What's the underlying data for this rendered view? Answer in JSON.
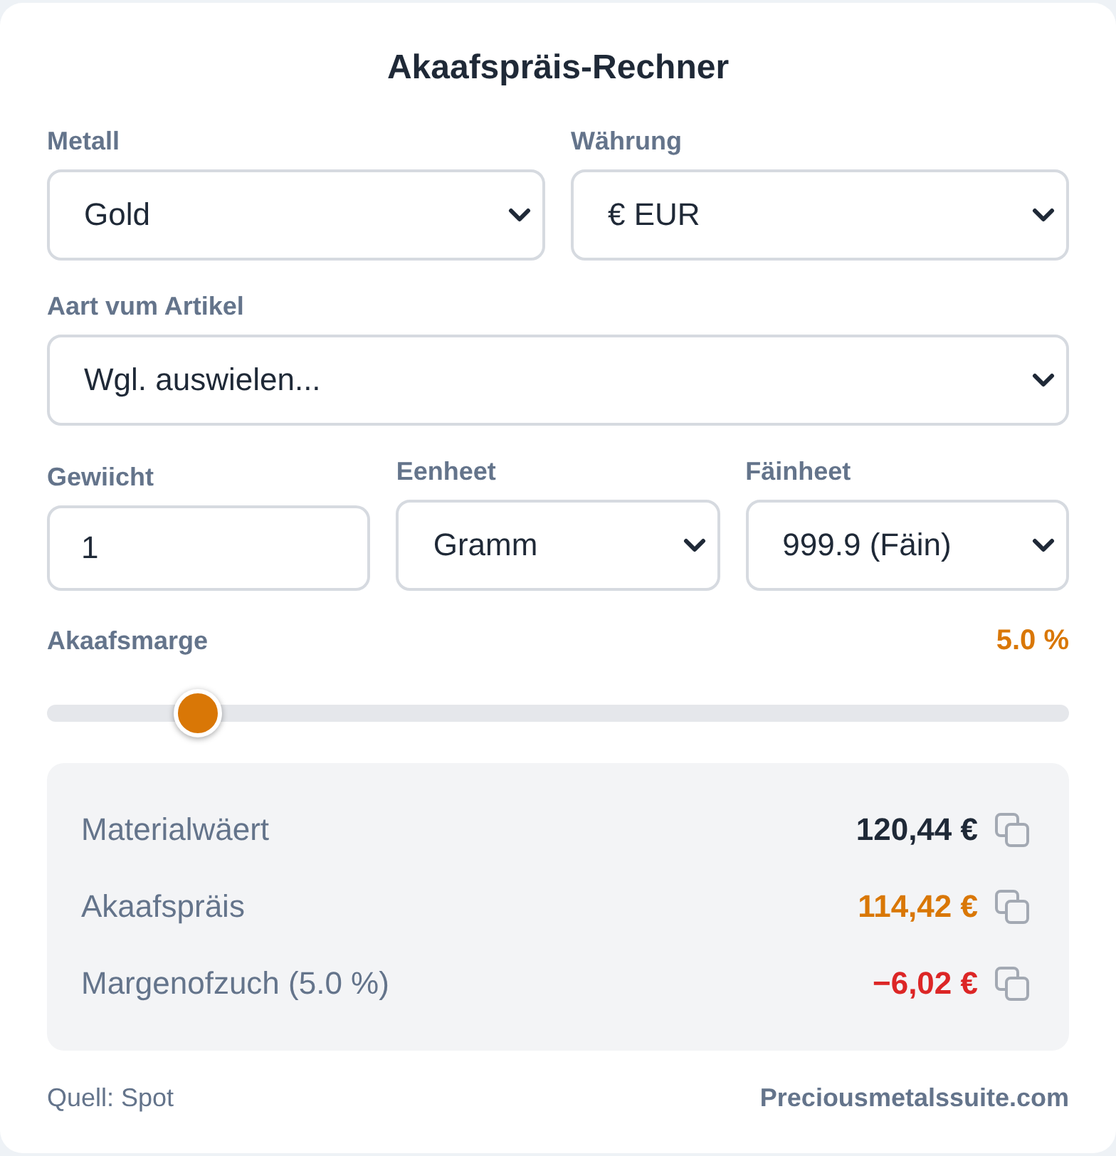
{
  "title": "Akaafspräis-Rechner",
  "field_rows": [
    [
      {
        "kind": "select",
        "label": "Metall",
        "value": "Gold"
      },
      {
        "kind": "select",
        "label": "Währung",
        "value": "€ EUR"
      }
    ],
    [
      {
        "kind": "select",
        "label": "Aart vum Artikel",
        "value": "Wgl. auswielen..."
      }
    ],
    [
      {
        "kind": "input",
        "label": "Gewiicht",
        "value": "1"
      },
      {
        "kind": "select",
        "label": "Eenheet",
        "value": "Gramm"
      },
      {
        "kind": "select",
        "label": "Fäinheet",
        "value": "999.9 (Fäin)"
      }
    ]
  ],
  "margin": {
    "label": "Akaafsmarge",
    "reading": "5.0 %",
    "level": 0.13
  },
  "results": [
    {
      "label": "Materialwäert",
      "value": "120,44 €",
      "color": "#1f2937"
    },
    {
      "label": "Akaafspräis",
      "value": "114,42 €",
      "color": "#d97706"
    },
    {
      "label": "Margenofzuch (5.0 %)",
      "value": "−6,02 €",
      "color": "#dc2626"
    }
  ],
  "footer": {
    "source": "Quell: Spot",
    "brand": "Preciousmetalssuite.com"
  }
}
